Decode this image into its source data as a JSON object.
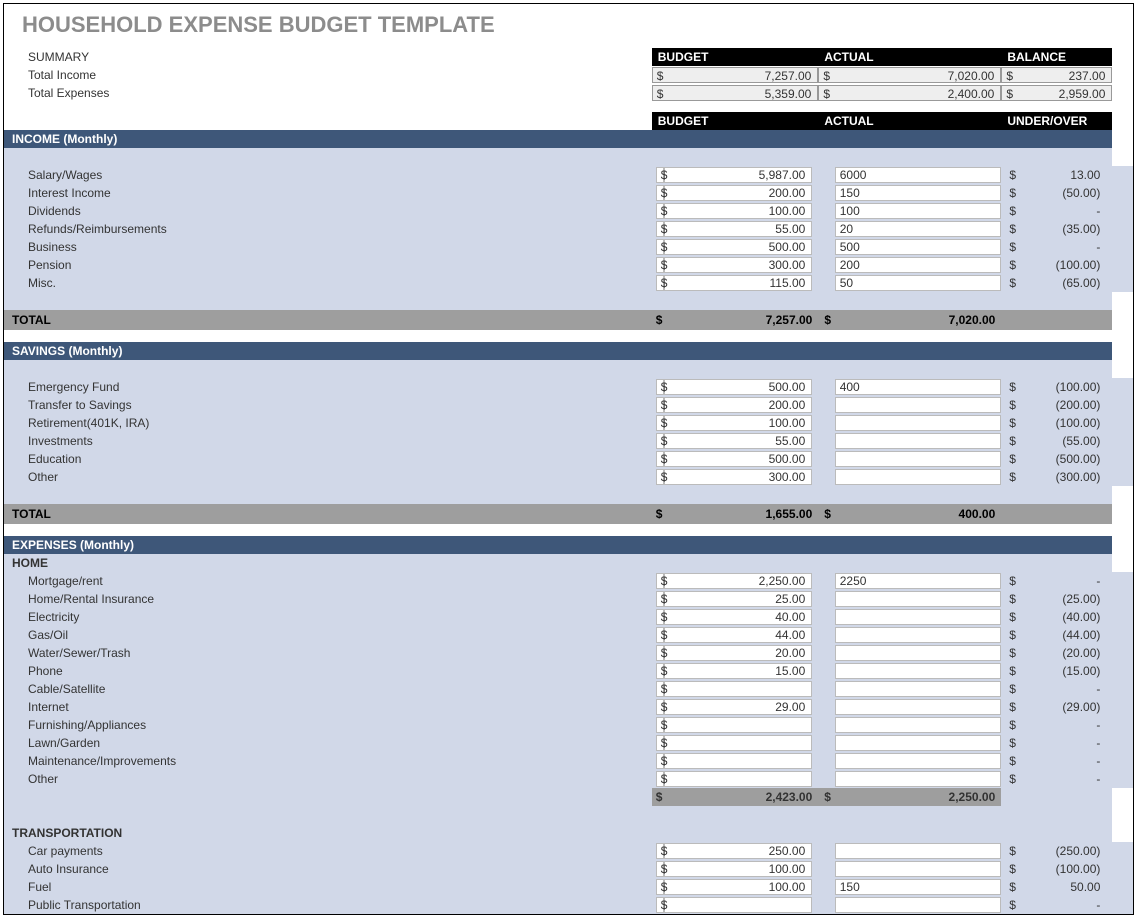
{
  "title": "HOUSEHOLD EXPENSE BUDGET TEMPLATE",
  "headers": {
    "budget": "BUDGET",
    "actual": "ACTUAL",
    "balance": "BALANCE",
    "underover": "UNDER/OVER",
    "summary": "SUMMARY",
    "total": "TOTAL"
  },
  "summary": {
    "rows": [
      {
        "label": "Total Income",
        "budget": "7,257.00",
        "actual": "7,020.00",
        "balance": "237.00"
      },
      {
        "label": "Total Expenses",
        "budget": "5,359.00",
        "actual": "2,400.00",
        "balance": "2,959.00"
      }
    ]
  },
  "sections": [
    {
      "title": "INCOME (Monthly)",
      "rows": [
        {
          "label": "Salary/Wages",
          "budget": "5,987.00",
          "actual": "6000",
          "uo": "13.00"
        },
        {
          "label": "Interest Income",
          "budget": "200.00",
          "actual": "150",
          "uo": "(50.00)"
        },
        {
          "label": "Dividends",
          "budget": "100.00",
          "actual": "100",
          "uo": "-"
        },
        {
          "label": "Refunds/Reimbursements",
          "budget": "55.00",
          "actual": "20",
          "uo": "(35.00)"
        },
        {
          "label": "Business",
          "budget": "500.00",
          "actual": "500",
          "uo": "-"
        },
        {
          "label": "Pension",
          "budget": "300.00",
          "actual": "200",
          "uo": "(100.00)"
        },
        {
          "label": "Misc.",
          "budget": "115.00",
          "actual": "50",
          "uo": "(65.00)"
        }
      ],
      "total": {
        "budget": "7,257.00",
        "actual": "7,020.00"
      }
    },
    {
      "title": "SAVINGS (Monthly)",
      "rows": [
        {
          "label": "Emergency Fund",
          "budget": "500.00",
          "actual": "400",
          "uo": "(100.00)"
        },
        {
          "label": "Transfer to Savings",
          "budget": "200.00",
          "actual": "",
          "uo": "(200.00)"
        },
        {
          "label": "Retirement(401K, IRA)",
          "budget": "100.00",
          "actual": "",
          "uo": "(100.00)"
        },
        {
          "label": "Investments",
          "budget": "55.00",
          "actual": "",
          "uo": "(55.00)"
        },
        {
          "label": "Education",
          "budget": "500.00",
          "actual": "",
          "uo": "(500.00)"
        },
        {
          "label": "Other",
          "budget": "300.00",
          "actual": "",
          "uo": "(300.00)"
        }
      ],
      "total": {
        "budget": "1,655.00",
        "actual": "400.00"
      }
    }
  ],
  "expenses": {
    "title": "EXPENSES (Monthly)",
    "groups": [
      {
        "name": "HOME",
        "rows": [
          {
            "label": "Mortgage/rent",
            "budget": "2,250.00",
            "actual": "2250",
            "uo": "-"
          },
          {
            "label": "Home/Rental Insurance",
            "budget": "25.00",
            "actual": "",
            "uo": "(25.00)"
          },
          {
            "label": "Electricity",
            "budget": "40.00",
            "actual": "",
            "uo": "(40.00)"
          },
          {
            "label": "Gas/Oil",
            "budget": "44.00",
            "actual": "",
            "uo": "(44.00)"
          },
          {
            "label": "Water/Sewer/Trash",
            "budget": "20.00",
            "actual": "",
            "uo": "(20.00)"
          },
          {
            "label": "Phone",
            "budget": "15.00",
            "actual": "",
            "uo": "(15.00)"
          },
          {
            "label": "Cable/Satellite",
            "budget": "",
            "actual": "",
            "uo": "-"
          },
          {
            "label": "Internet",
            "budget": "29.00",
            "actual": "",
            "uo": "(29.00)"
          },
          {
            "label": "Furnishing/Appliances",
            "budget": "",
            "actual": "",
            "uo": "-"
          },
          {
            "label": "Lawn/Garden",
            "budget": "",
            "actual": "",
            "uo": "-"
          },
          {
            "label": "Maintenance/Improvements",
            "budget": "",
            "actual": "",
            "uo": "-"
          },
          {
            "label": "Other",
            "budget": "",
            "actual": "",
            "uo": "-"
          }
        ],
        "subtotal": {
          "budget": "2,423.00",
          "actual": "2,250.00"
        }
      },
      {
        "name": "TRANSPORTATION",
        "rows": [
          {
            "label": "Car payments",
            "budget": "250.00",
            "actual": "",
            "uo": "(250.00)"
          },
          {
            "label": "Auto Insurance",
            "budget": "100.00",
            "actual": "",
            "uo": "(100.00)"
          },
          {
            "label": "Fuel",
            "budget": "100.00",
            "actual": "150",
            "uo": "50.00"
          },
          {
            "label": "Public Transportation",
            "budget": "",
            "actual": "",
            "uo": "-"
          }
        ]
      }
    ]
  },
  "sym": "$"
}
